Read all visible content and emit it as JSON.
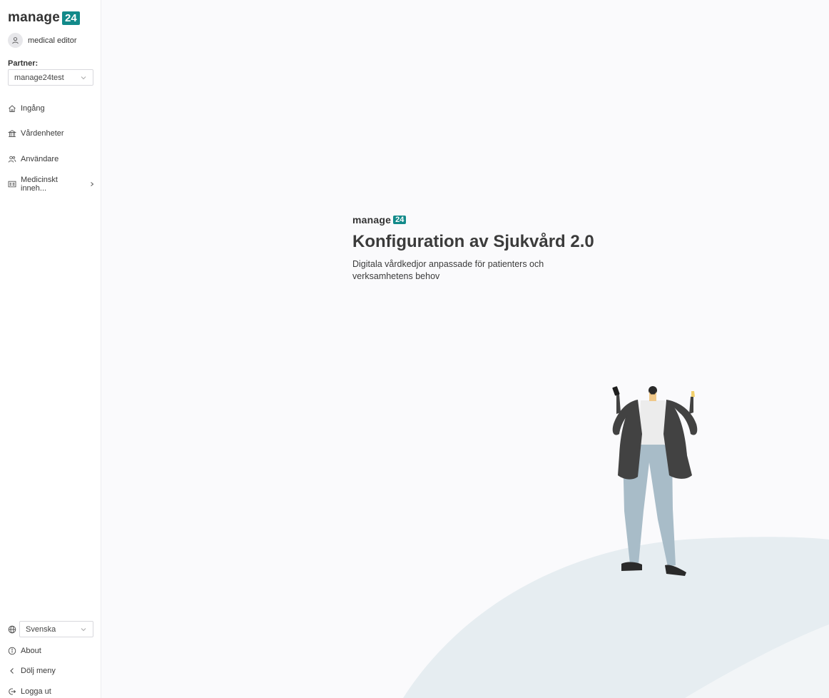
{
  "brand": {
    "word": "manage",
    "badge": "24",
    "color": "#128a8a"
  },
  "user": {
    "name": "medical editor",
    "icon": "user-icon"
  },
  "partner": {
    "label": "Partner:",
    "selected": "manage24test"
  },
  "nav": [
    {
      "label": "Ingång",
      "icon": "home-icon"
    },
    {
      "label": "Vårdenheter",
      "icon": "building-icon"
    },
    {
      "label": "Användare",
      "icon": "users-icon"
    },
    {
      "label": "Medicinskt inneh...",
      "icon": "document-list-icon"
    }
  ],
  "footer": {
    "language": "Svenska",
    "about": "About",
    "hide_menu": "Dölj meny",
    "logout": "Logga ut"
  },
  "main": {
    "title": "Konfiguration av Sjukvård 2.0",
    "subtitle": "Digitala vårdkedjor anpassade för patienters och verksamhetens behov"
  }
}
